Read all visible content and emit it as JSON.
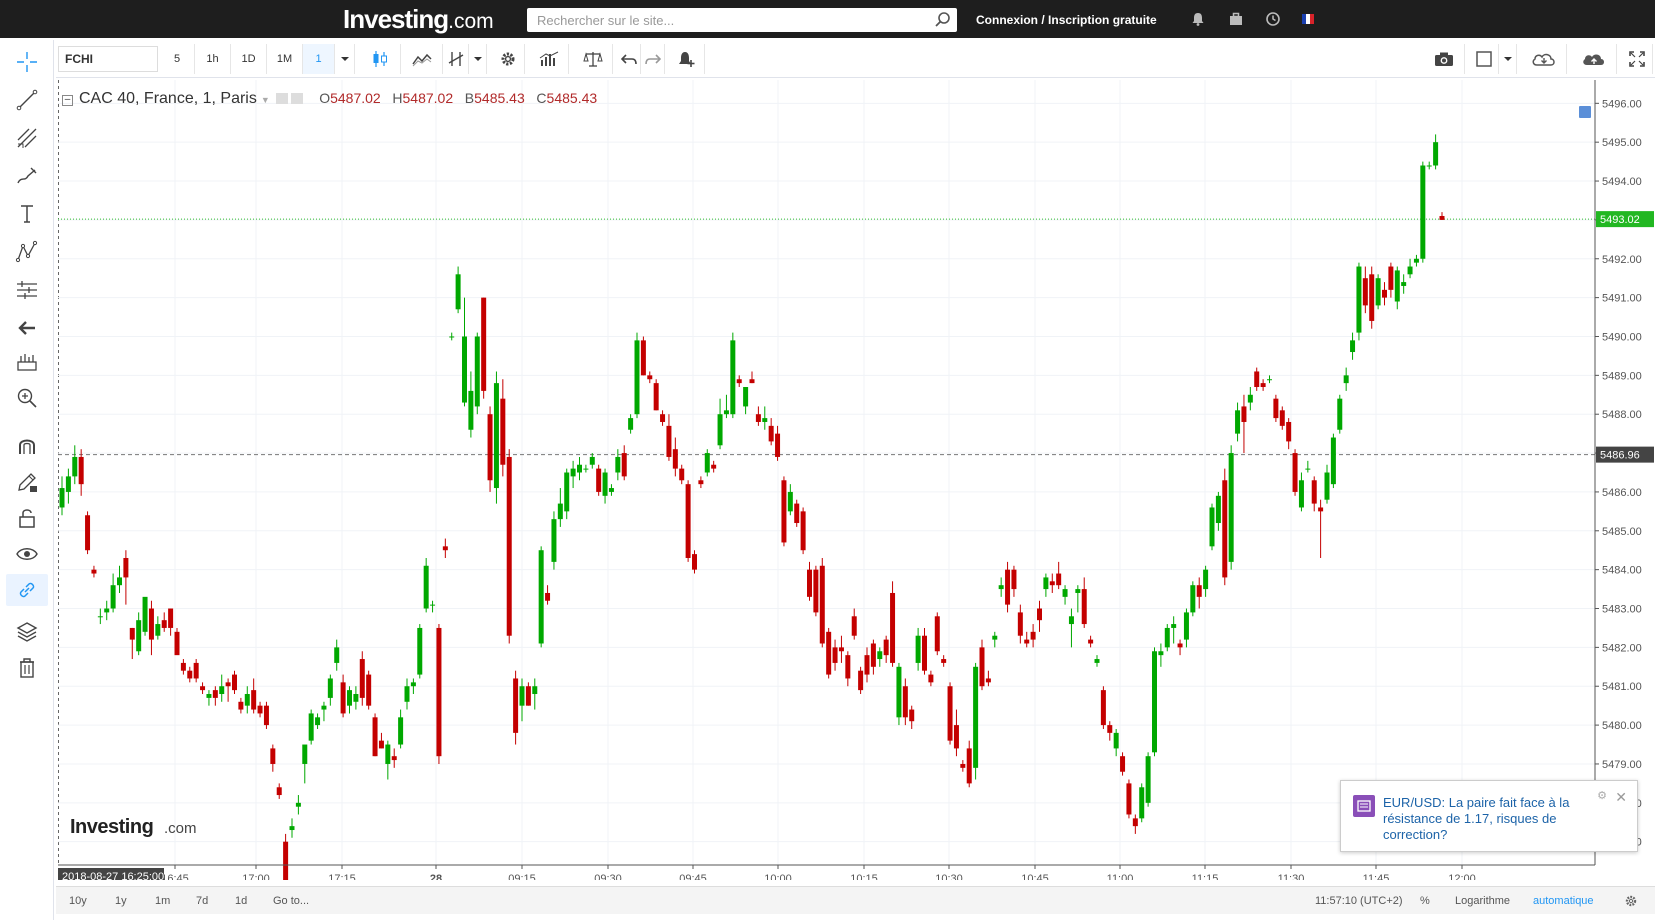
{
  "header": {
    "logo_main": "Investing",
    "logo_suffix": ".com",
    "search_placeholder": "Rechercher sur le site...",
    "login_label": "Connexion",
    "login_separator": "/",
    "signup_label": "Inscription gratuite"
  },
  "toolbar": {
    "symbol": "FCHI",
    "intervals": [
      "5",
      "1h",
      "1D",
      "1M",
      "1"
    ],
    "active_interval": "1"
  },
  "legend": {
    "title": "CAC 40, France, 1, Paris",
    "open_label": "O",
    "open": "5487.02",
    "high_label": "H",
    "high": "5487.02",
    "low_label": "B",
    "low": "5485.43",
    "close_label": "C",
    "close": "5485.43"
  },
  "watermark": {
    "main": "Investing",
    "suffix": ".com"
  },
  "chart_data": {
    "type": "candlestick",
    "title": "CAC 40, France, 1, Paris",
    "ylim": [
      5476.4,
      5496.6
    ],
    "y_ticks": [
      "5496.00",
      "5495.00",
      "5494.00",
      "5493.00",
      "5492.00",
      "5491.00",
      "5490.00",
      "5489.00",
      "5488.00",
      "5487.00",
      "5486.00",
      "5485.00",
      "5484.00",
      "5483.00",
      "5482.00",
      "5481.00",
      "5480.00",
      "5479.00",
      "5478.00",
      "5477.00"
    ],
    "x_ticks": [
      "16:45",
      "17:00",
      "17:15",
      "28",
      "09:15",
      "09:30",
      "09:45",
      "10:00",
      "10:15",
      "10:30",
      "10:45",
      "11:00",
      "11:15",
      "11:30",
      "11:45",
      "12:00"
    ],
    "current_price": "5493.02",
    "reference_price": "5486.96",
    "crosshair_date": "2018-08-27 16:25:00",
    "up_color": "#00a800",
    "down_color": "#c40000",
    "candles": [
      [
        5485.6,
        5486.4,
        5485.4,
        5486.1
      ],
      [
        5486.0,
        5486.6,
        5485.7,
        5486.4
      ],
      [
        5486.4,
        5487.2,
        5486.2,
        5486.9
      ],
      [
        5486.9,
        5487.1,
        5485.9,
        5486.2
      ],
      [
        5485.4,
        5485.5,
        5484.4,
        5484.5
      ],
      [
        5484.0,
        5484.1,
        5483.8,
        5483.9
      ],
      [
        5482.8,
        5483.0,
        5482.6,
        5482.8
      ],
      [
        5482.9,
        5483.2,
        5482.7,
        5483.0
      ],
      [
        5483.0,
        5483.9,
        5482.9,
        5483.6
      ],
      [
        5483.6,
        5484.1,
        5483.4,
        5483.8
      ],
      [
        5484.3,
        5484.5,
        5483.1,
        5483.8
      ],
      [
        5482.5,
        5482.5,
        5481.7,
        5482.2
      ],
      [
        5481.9,
        5482.9,
        5481.8,
        5482.7
      ],
      [
        5482.4,
        5483.2,
        5482.3,
        5483.3
      ],
      [
        5483.0,
        5483.2,
        5481.8,
        5482.2
      ],
      [
        5482.3,
        5482.8,
        5482.2,
        5482.6
      ],
      [
        5482.7,
        5482.9,
        5482.4,
        5482.5
      ],
      [
        5483.0,
        5483.0,
        5482.3,
        5482.5
      ],
      [
        5482.4,
        5482.5,
        5481.9,
        5481.8
      ],
      [
        5481.6,
        5481.7,
        5481.3,
        5481.4
      ],
      [
        5481.4,
        5481.5,
        5481.1,
        5481.2
      ],
      [
        5481.6,
        5481.7,
        5481.1,
        5481.2
      ],
      [
        5481.0,
        5481.1,
        5480.8,
        5480.9
      ],
      [
        5480.7,
        5480.9,
        5480.5,
        5480.8
      ],
      [
        5480.9,
        5481.0,
        5480.5,
        5480.7
      ],
      [
        5480.8,
        5481.3,
        5480.6,
        5481.0
      ],
      [
        5481.1,
        5481.2,
        5480.6,
        5481.0
      ],
      [
        5481.3,
        5481.4,
        5480.8,
        5480.9
      ],
      [
        5480.6,
        5480.7,
        5480.3,
        5480.4
      ],
      [
        5480.5,
        5481.0,
        5480.3,
        5480.8
      ],
      [
        5480.9,
        5481.2,
        5480.3,
        5480.4
      ],
      [
        5480.5,
        5480.6,
        5480.2,
        5480.3
      ],
      [
        5480.5,
        5480.6,
        5479.9,
        5480.0
      ],
      [
        5479.4,
        5479.5,
        5478.8,
        5479.0
      ],
      [
        5478.4,
        5478.5,
        5478.1,
        5478.2
      ],
      [
        5477.0,
        5477.2,
        5475.9,
        5476.0
      ],
      [
        5477.3,
        5477.6,
        5477.1,
        5477.4
      ],
      [
        5477.9,
        5478.2,
        5477.7,
        5478.0
      ],
      [
        5479.0,
        5479.2,
        5478.5,
        5479.5
      ],
      [
        5479.6,
        5480.4,
        5479.5,
        5480.3
      ],
      [
        5480.0,
        5480.3,
        5479.9,
        5480.2
      ],
      [
        5480.4,
        5480.6,
        5480.1,
        5480.5
      ],
      [
        5480.7,
        5481.3,
        5480.5,
        5481.2
      ],
      [
        5481.6,
        5482.2,
        5481.4,
        5482.0
      ],
      [
        5481.1,
        5481.3,
        5480.2,
        5480.3
      ],
      [
        5480.5,
        5481.0,
        5480.3,
        5480.9
      ],
      [
        5480.6,
        5481.0,
        5480.4,
        5480.8
      ],
      [
        5481.7,
        5481.9,
        5480.5,
        5480.7
      ],
      [
        5481.3,
        5481.4,
        5480.4,
        5480.5
      ],
      [
        5480.2,
        5480.3,
        5479.2,
        5479.2
      ],
      [
        5479.6,
        5479.8,
        5479.4,
        5479.4
      ],
      [
        5479.0,
        5479.6,
        5478.6,
        5479.5
      ],
      [
        5479.2,
        5479.4,
        5478.9,
        5479.1
      ],
      [
        5479.5,
        5480.4,
        5479.4,
        5480.2
      ],
      [
        5480.6,
        5481.2,
        5480.4,
        5481.0
      ],
      [
        5481.0,
        5481.2,
        5480.8,
        5481.1
      ],
      [
        5481.3,
        5482.6,
        5481.2,
        5482.5
      ],
      [
        5483.0,
        5484.3,
        5482.9,
        5484.1
      ],
      [
        5483.1,
        5483.2,
        5482.9,
        5483.1
      ],
      [
        5482.5,
        5482.6,
        5479.0,
        5479.2
      ],
      [
        5484.6,
        5484.8,
        5484.3,
        5484.5
      ],
      [
        5490.0,
        5490.1,
        5489.9,
        5490.0
      ],
      [
        5490.7,
        5491.8,
        5490.6,
        5491.6
      ],
      [
        5488.3,
        5491.0,
        5488.2,
        5490.0
      ],
      [
        5487.6,
        5489.1,
        5487.4,
        5488.6
      ],
      [
        5488.2,
        5490.1,
        5488.0,
        5490.0
      ],
      [
        5491.0,
        5491.0,
        5488.4,
        5488.6
      ],
      [
        5488.0,
        5488.2,
        5486.0,
        5486.3
      ],
      [
        5486.1,
        5489.1,
        5485.7,
        5488.8
      ],
      [
        5488.4,
        5488.9,
        5486.4,
        5486.7
      ],
      [
        5486.9,
        5487.1,
        5482.1,
        5482.3
      ],
      [
        5481.2,
        5481.4,
        5479.5,
        5479.8
      ],
      [
        5480.5,
        5481.2,
        5480.1,
        5481.0
      ],
      [
        5481.0,
        5481.1,
        5480.5,
        5480.5
      ],
      [
        5480.8,
        5481.2,
        5480.4,
        5481.0
      ],
      [
        5482.1,
        5484.6,
        5482.0,
        5484.5
      ],
      [
        5483.4,
        5483.6,
        5483.1,
        5483.2
      ],
      [
        5484.2,
        5485.5,
        5484.0,
        5485.3
      ],
      [
        5485.3,
        5486.1,
        5485.1,
        5485.7
      ],
      [
        5485.5,
        5486.6,
        5485.3,
        5486.5
      ],
      [
        5486.4,
        5486.8,
        5486.1,
        5486.6
      ],
      [
        5486.5,
        5486.9,
        5486.3,
        5486.7
      ],
      [
        5486.6,
        5486.7,
        5486.5,
        5486.6
      ],
      [
        5486.7,
        5487.0,
        5486.6,
        5486.9
      ],
      [
        5486.6,
        5486.7,
        5485.9,
        5486.0
      ],
      [
        5485.9,
        5486.6,
        5485.7,
        5486.5
      ],
      [
        5486.0,
        5486.2,
        5485.9,
        5486.1
      ],
      [
        5486.5,
        5487.1,
        5486.3,
        5486.9
      ],
      [
        5487.0,
        5487.2,
        5486.3,
        5486.4
      ],
      [
        5487.6,
        5488.0,
        5487.5,
        5487.9
      ],
      [
        5488.0,
        5490.1,
        5487.9,
        5489.9
      ],
      [
        5489.9,
        5490.0,
        5489.0,
        5489.0
      ],
      [
        5489.0,
        5489.1,
        5488.8,
        5488.9
      ],
      [
        5488.8,
        5488.9,
        5488.1,
        5488.1
      ],
      [
        5488.0,
        5488.1,
        5487.7,
        5487.8
      ],
      [
        5487.7,
        5488.0,
        5486.8,
        5486.9
      ],
      [
        5487.1,
        5487.4,
        5486.4,
        5486.6
      ],
      [
        5486.6,
        5486.7,
        5486.2,
        5486.3
      ],
      [
        5486.2,
        5486.3,
        5484.2,
        5484.3
      ],
      [
        5484.4,
        5484.5,
        5483.9,
        5484.0
      ],
      [
        5486.3,
        5486.4,
        5486.1,
        5486.2
      ],
      [
        5486.5,
        5487.1,
        5486.4,
        5487.0
      ],
      [
        5486.7,
        5486.8,
        5486.5,
        5486.6
      ],
      [
        5487.2,
        5488.4,
        5487.1,
        5488.0
      ],
      [
        5488.0,
        5488.5,
        5487.9,
        5488.1
      ],
      [
        5488.0,
        5490.1,
        5487.9,
        5489.9
      ],
      [
        5488.9,
        5489.0,
        5488.7,
        5488.8
      ],
      [
        5488.2,
        5488.7,
        5488.0,
        5488.7
      ],
      [
        5488.9,
        5489.1,
        5488.8,
        5488.8
      ],
      [
        5488.0,
        5488.2,
        5487.7,
        5487.8
      ],
      [
        5487.8,
        5488.2,
        5487.6,
        5487.9
      ],
      [
        5487.7,
        5487.9,
        5487.2,
        5487.3
      ],
      [
        5487.5,
        5487.7,
        5486.8,
        5486.9
      ],
      [
        5486.3,
        5486.4,
        5484.6,
        5484.7
      ],
      [
        5485.5,
        5486.2,
        5485.4,
        5486.0
      ],
      [
        5485.7,
        5485.8,
        5485.1,
        5485.2
      ],
      [
        5485.5,
        5485.6,
        5484.4,
        5484.5
      ],
      [
        5484.0,
        5484.2,
        5483.2,
        5483.3
      ],
      [
        5484.0,
        5484.1,
        5482.8,
        5482.9
      ],
      [
        5484.1,
        5484.3,
        5482.0,
        5482.1
      ],
      [
        5482.4,
        5482.5,
        5481.2,
        5481.3
      ],
      [
        5482.0,
        5482.2,
        5481.4,
        5481.6
      ],
      [
        5482.0,
        5482.3,
        5481.6,
        5481.9
      ],
      [
        5481.8,
        5481.9,
        5481.0,
        5481.2
      ],
      [
        5482.8,
        5483.0,
        5482.2,
        5482.3
      ],
      [
        5481.4,
        5481.5,
        5480.8,
        5480.9
      ],
      [
        5481.8,
        5482.0,
        5481.1,
        5481.3
      ],
      [
        5482.1,
        5482.2,
        5481.3,
        5481.5
      ],
      [
        5481.7,
        5482.0,
        5481.5,
        5481.9
      ],
      [
        5482.2,
        5482.3,
        5481.6,
        5481.8
      ],
      [
        5483.4,
        5483.7,
        5481.5,
        5481.6
      ],
      [
        5480.2,
        5481.6,
        5480.0,
        5481.5
      ],
      [
        5481.0,
        5481.2,
        5480.0,
        5480.2
      ],
      [
        5480.4,
        5480.5,
        5479.9,
        5480.1
      ],
      [
        5481.6,
        5482.5,
        5481.4,
        5482.3
      ],
      [
        5482.3,
        5482.5,
        5481.3,
        5481.4
      ],
      [
        5481.3,
        5481.4,
        5481.0,
        5481.1
      ],
      [
        5482.8,
        5482.9,
        5481.8,
        5481.9
      ],
      [
        5481.7,
        5481.8,
        5481.5,
        5481.6
      ],
      [
        5481.0,
        5481.1,
        5479.5,
        5479.6
      ],
      [
        5480.0,
        5480.4,
        5479.2,
        5479.4
      ],
      [
        5479.0,
        5479.1,
        5478.8,
        5478.9
      ],
      [
        5479.4,
        5479.6,
        5478.4,
        5478.5
      ],
      [
        5478.9,
        5481.6,
        5478.6,
        5481.5
      ],
      [
        5482.0,
        5482.2,
        5480.9,
        5481.0
      ],
      [
        5481.2,
        5481.4,
        5481.0,
        5481.1
      ],
      [
        5482.2,
        5482.4,
        5482.0,
        5482.3
      ],
      [
        5483.5,
        5483.8,
        5483.3,
        5483.6
      ],
      [
        5484.0,
        5484.2,
        5482.9,
        5483.1
      ],
      [
        5484.0,
        5484.1,
        5483.3,
        5483.5
      ],
      [
        5482.9,
        5483.1,
        5482.1,
        5482.3
      ],
      [
        5482.2,
        5482.4,
        5482.0,
        5482.1
      ],
      [
        5482.4,
        5482.6,
        5482.0,
        5482.2
      ],
      [
        5483.0,
        5483.2,
        5482.4,
        5482.7
      ],
      [
        5483.5,
        5483.9,
        5483.3,
        5483.8
      ],
      [
        5483.7,
        5483.9,
        5483.4,
        5483.6
      ],
      [
        5483.9,
        5484.2,
        5483.5,
        5483.6
      ],
      [
        5483.3,
        5483.6,
        5483.1,
        5483.5
      ],
      [
        5482.6,
        5483.0,
        5482.0,
        5482.8
      ],
      [
        5483.4,
        5483.6,
        5482.9,
        5483.5
      ],
      [
        5483.5,
        5483.8,
        5482.5,
        5482.6
      ],
      [
        5482.2,
        5482.3,
        5482.0,
        5482.1
      ],
      [
        5481.6,
        5481.8,
        5481.5,
        5481.7
      ],
      [
        5480.9,
        5481.0,
        5479.9,
        5480.0
      ],
      [
        5480.0,
        5480.1,
        5479.6,
        5479.8
      ],
      [
        5479.4,
        5479.9,
        5479.2,
        5479.8
      ],
      [
        5479.2,
        5479.3,
        5478.7,
        5478.8
      ],
      [
        5478.5,
        5478.6,
        5477.6,
        5477.7
      ],
      [
        5477.6,
        5477.7,
        5477.2,
        5477.4
      ],
      [
        5477.6,
        5478.5,
        5477.5,
        5478.4
      ],
      [
        5478.0,
        5479.3,
        5477.9,
        5479.2
      ],
      [
        5479.3,
        5482.0,
        5479.2,
        5481.9
      ],
      [
        5481.8,
        5482.1,
        5481.5,
        5481.9
      ],
      [
        5482.0,
        5482.6,
        5481.9,
        5482.5
      ],
      [
        5482.5,
        5482.8,
        5482.1,
        5482.6
      ],
      [
        5482.1,
        5482.2,
        5481.8,
        5482.0
      ],
      [
        5482.2,
        5483.0,
        5482.0,
        5482.9
      ],
      [
        5482.9,
        5483.7,
        5482.8,
        5483.6
      ],
      [
        5483.6,
        5483.8,
        5483.0,
        5483.3
      ],
      [
        5483.5,
        5484.1,
        5483.3,
        5484.0
      ],
      [
        5484.6,
        5485.7,
        5484.5,
        5485.6
      ],
      [
        5485.2,
        5486.0,
        5485.0,
        5485.9
      ],
      [
        5486.3,
        5486.6,
        5483.6,
        5483.8
      ],
      [
        5484.2,
        5487.2,
        5484.0,
        5487.0
      ],
      [
        5487.5,
        5488.3,
        5487.3,
        5488.1
      ],
      [
        5488.2,
        5488.5,
        5487.0,
        5487.8
      ],
      [
        5488.3,
        5488.7,
        5488.1,
        5488.5
      ],
      [
        5489.1,
        5489.2,
        5488.6,
        5488.7
      ],
      [
        5488.8,
        5488.9,
        5488.6,
        5488.7
      ],
      [
        5488.9,
        5489.0,
        5488.8,
        5488.9
      ],
      [
        5488.4,
        5488.5,
        5487.8,
        5487.9
      ],
      [
        5488.1,
        5488.2,
        5487.6,
        5487.7
      ],
      [
        5487.8,
        5487.9,
        5487.1,
        5487.3
      ],
      [
        5487.0,
        5487.1,
        5485.9,
        5486.0
      ],
      [
        5485.6,
        5486.5,
        5485.5,
        5486.3
      ],
      [
        5486.6,
        5486.8,
        5486.5,
        5486.6
      ],
      [
        5486.3,
        5486.4,
        5485.5,
        5485.7
      ],
      [
        5485.6,
        5485.8,
        5484.3,
        5485.5
      ],
      [
        5485.8,
        5486.7,
        5485.7,
        5486.5
      ],
      [
        5486.2,
        5487.5,
        5486.1,
        5487.4
      ],
      [
        5487.6,
        5488.5,
        5487.5,
        5488.4
      ],
      [
        5488.8,
        5489.2,
        5488.6,
        5489.0
      ],
      [
        5489.6,
        5490.1,
        5489.4,
        5489.9
      ],
      [
        5490.1,
        5491.9,
        5489.9,
        5491.8
      ],
      [
        5491.5,
        5491.8,
        5490.6,
        5490.8
      ],
      [
        5491.6,
        5491.8,
        5490.2,
        5490.4
      ],
      [
        5490.8,
        5491.6,
        5490.7,
        5491.5
      ],
      [
        5491.2,
        5491.4,
        5490.8,
        5491.0
      ],
      [
        5491.8,
        5491.9,
        5491.0,
        5491.2
      ],
      [
        5490.9,
        5491.8,
        5490.7,
        5491.7
      ],
      [
        5491.3,
        5491.6,
        5491.1,
        5491.4
      ],
      [
        5491.6,
        5492.0,
        5491.5,
        5491.8
      ],
      [
        5491.9,
        5492.1,
        5491.8,
        5492.0
      ],
      [
        5492.0,
        5494.5,
        5491.9,
        5494.4
      ],
      [
        5494.4,
        5494.5,
        5494.3,
        5494.4
      ],
      [
        5494.4,
        5495.2,
        5494.3,
        5495.0
      ],
      [
        5493.1,
        5493.2,
        5493.0,
        5493.0
      ]
    ]
  },
  "bottom": {
    "ranges": [
      "10y",
      "1y",
      "1m",
      "7d",
      "1d"
    ],
    "goto_label": "Go to...",
    "time_label": "11:57:10 (UTC+2)",
    "percent_label": "%",
    "log_label": "Logarithme",
    "auto_label": "automatique"
  },
  "news": {
    "headline": "EUR/USD: La paire fait face à la résistance de 1.17, risques de correction?"
  }
}
